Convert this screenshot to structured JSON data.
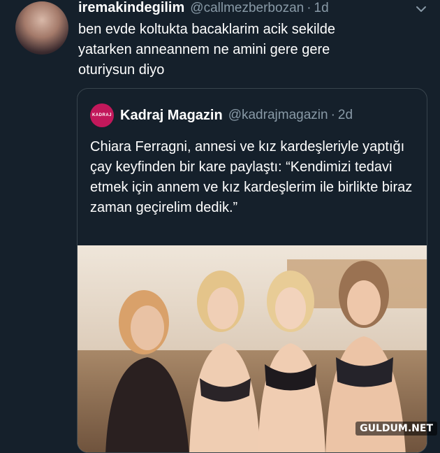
{
  "tweet": {
    "display_name": "iremakindegilim",
    "handle": "@callmezberbozan",
    "time": "1d",
    "text": "ben evde koltukta bacaklarim acik sekilde yatarken anneannem ne amini gere gere oturiysun diyo"
  },
  "quote": {
    "logo_text": "KADRAJ",
    "display_name": "Kadraj Magazin",
    "handle": "@kadrajmagazin",
    "time": "2d",
    "text": "Chiara Ferragni, annesi ve kız kardeşleriyle yaptığı çay keyfinden bir kare paylaştı: “Kendimizi tedavi etmek için annem ve kız kardeşlerim ile birlikte biraz zaman geçirelim dedik.”"
  },
  "icons": {
    "menu": "chevron-down-icon"
  },
  "watermark": "GULDUM.NET",
  "colors": {
    "background": "#15202b",
    "secondary_text": "#8899a6",
    "border": "#38444d"
  }
}
